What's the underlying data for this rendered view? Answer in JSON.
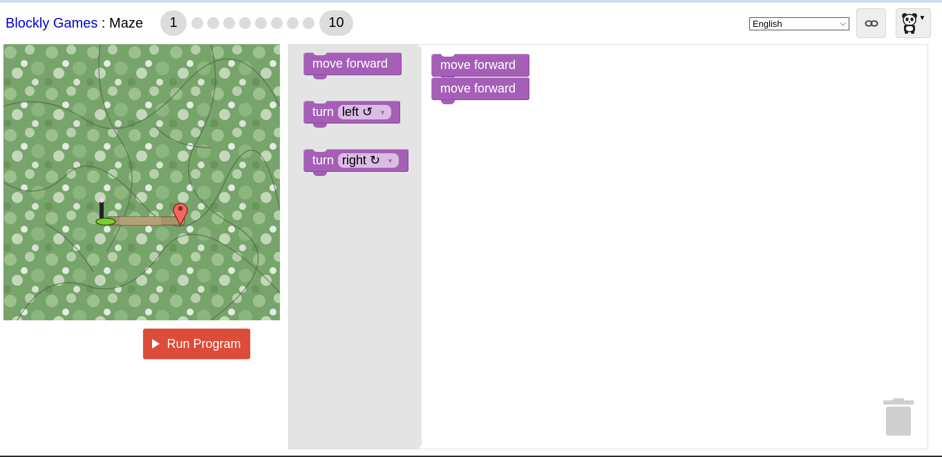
{
  "header": {
    "app_title": "Blockly Games",
    "separator": " : ",
    "game_title": "Maze",
    "level_first": "1",
    "level_last": "10",
    "language": "English",
    "link_icon": "link-icon",
    "menu_icon": "panda-icon"
  },
  "maze": {
    "start_icon": "pegman-icon",
    "goal_icon": "map-marker-icon",
    "run_label": "Run Program"
  },
  "toolbox": {
    "blocks": [
      {
        "label": "move forward"
      },
      {
        "label": "turn",
        "option": "left ↺"
      },
      {
        "label": "turn",
        "option": "right ↻"
      }
    ]
  },
  "workspace": {
    "blocks": [
      {
        "label": "move forward"
      },
      {
        "label": "move forward"
      }
    ],
    "trash_icon": "trash-icon"
  },
  "colors": {
    "block": "#a55fb7",
    "run_button": "#dd4b39",
    "link": "#0000cc",
    "flyout": "#e4e4e4"
  }
}
